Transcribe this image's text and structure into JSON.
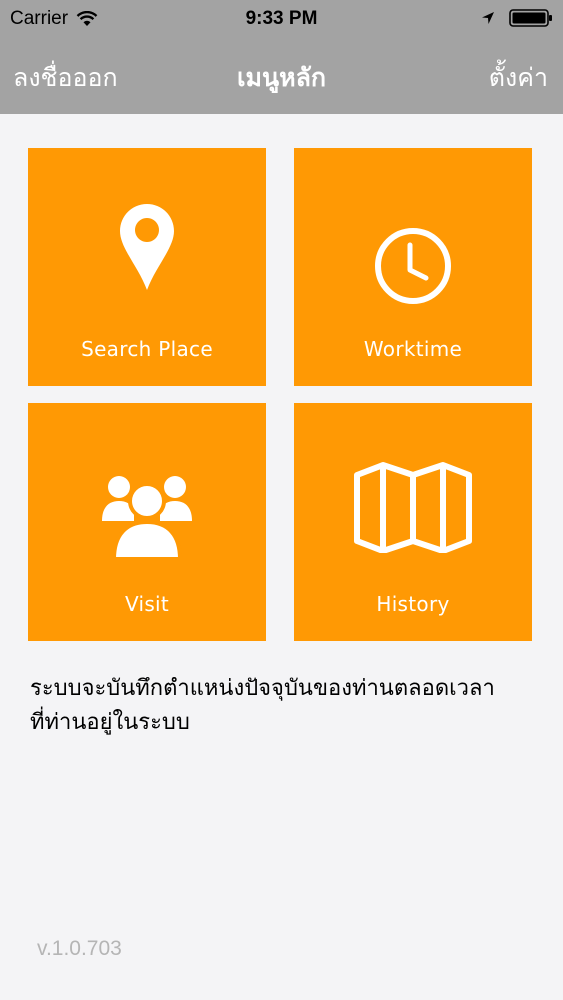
{
  "status_bar": {
    "carrier": "Carrier",
    "time": "9:33 PM",
    "icons": [
      "wifi-icon",
      "location-arrow-icon",
      "battery-icon"
    ]
  },
  "nav": {
    "left_label": "ลงชื่อออก",
    "title": "เมนูหลัก",
    "right_label": "ตั้งค่า"
  },
  "tiles": [
    {
      "label": "Search Place",
      "icon": "map-pin-icon"
    },
    {
      "label": "Worktime",
      "icon": "clock-icon"
    },
    {
      "label": "Visit",
      "icon": "people-icon"
    },
    {
      "label": "History",
      "icon": "folded-map-icon"
    }
  ],
  "info": {
    "line1": "ระบบจะบันทึกตำแหน่งปัจจุบันของท่านตลอดเวลา",
    "line2": "ที่ท่านอยู่ในระบบ"
  },
  "version": "v.1.0.703",
  "colors": {
    "header": "#a3a3a3",
    "tile": "#ff9904",
    "background": "#f4f4f6",
    "version_text": "#b5b5b5"
  }
}
